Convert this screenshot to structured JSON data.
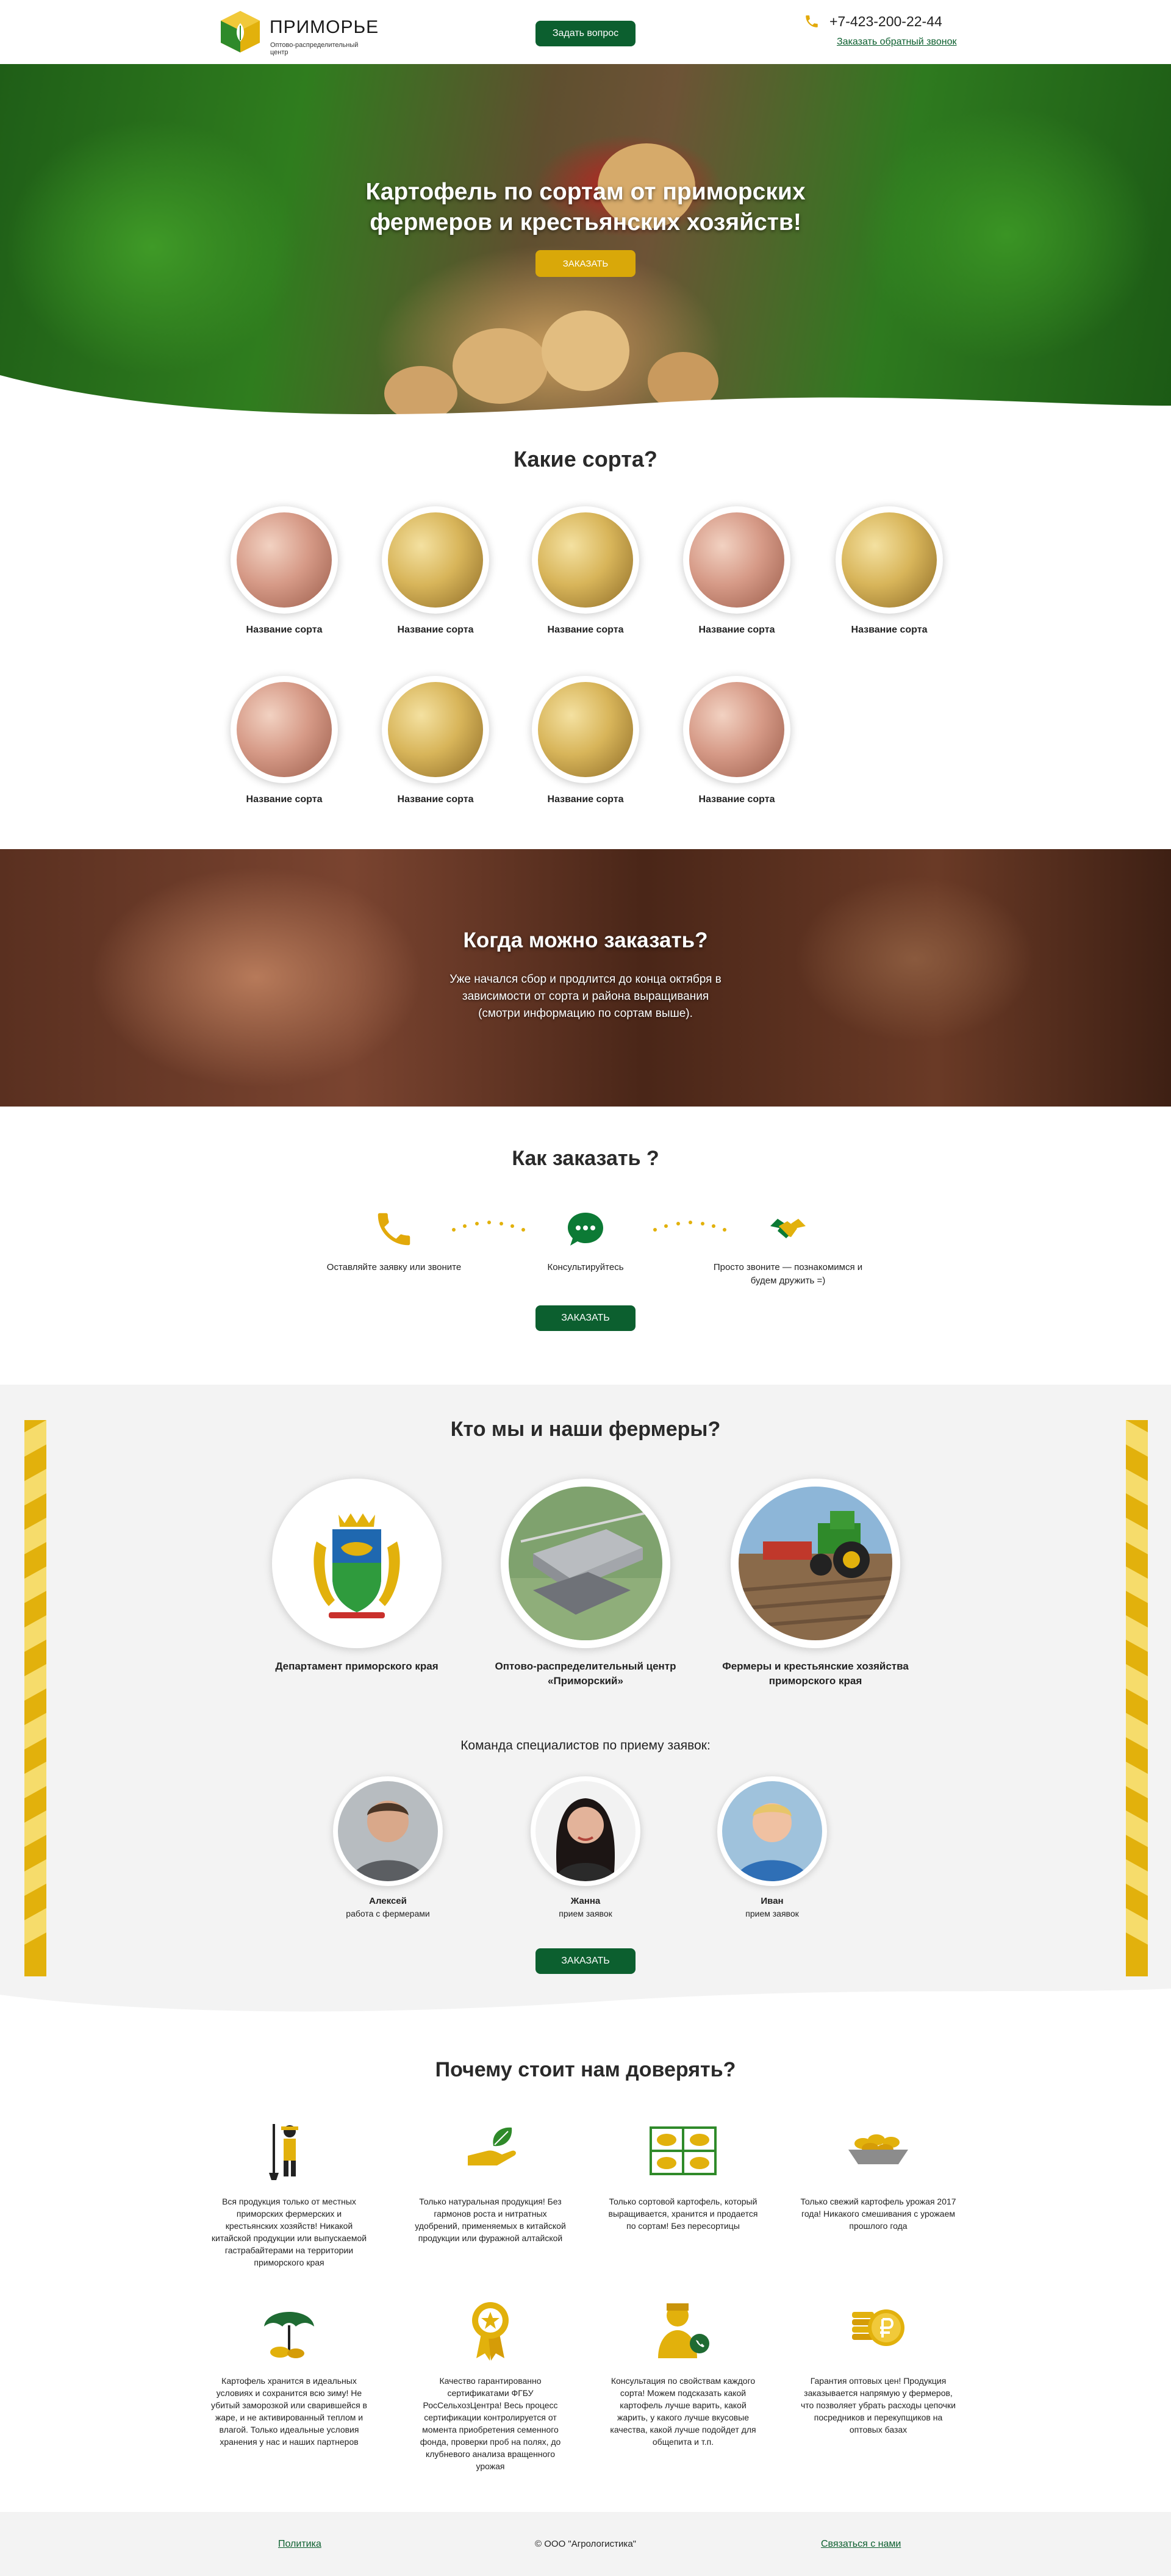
{
  "header": {
    "logo_title": "ПРИМОРЬЕ",
    "logo_subtitle": "Оптово-распределительный центр",
    "ask_button": "Задать вопрос",
    "phone": "+7-423-200-22-44",
    "callback_link": "Заказать обратный звонок"
  },
  "hero": {
    "title": "Картофель по сортам от приморских фермеров и крестьянских хозяйств!",
    "order_button": "ЗАКАЗАТЬ"
  },
  "sorts": {
    "title": "Какие сорта?",
    "items": [
      {
        "label": "Название сорта",
        "color": "pink"
      },
      {
        "label": "Название сорта",
        "color": "yellow"
      },
      {
        "label": "Название сорта",
        "color": "yellow"
      },
      {
        "label": "Название сорта",
        "color": "pink"
      },
      {
        "label": "Название сорта",
        "color": "yellow"
      },
      {
        "label": "Название сорта",
        "color": "pink"
      },
      {
        "label": "Название сорта",
        "color": "yellow"
      },
      {
        "label": "Название сорта",
        "color": "yellow"
      },
      {
        "label": "Название сорта",
        "color": "pink"
      }
    ]
  },
  "when": {
    "title": "Когда можно заказать?",
    "text": "Уже начался сбор и продлится до конца октября в зависимости от сорта и района выращивания (смотри информацию по сортам выше)."
  },
  "how": {
    "title": "Как заказать ?",
    "steps": [
      {
        "label": "Оставляйте заявку или звоните",
        "icon": "phone-icon"
      },
      {
        "label": "Консультируйтесь",
        "icon": "chat-bubble-icon"
      },
      {
        "label": "Просто звоните — познакомимся и будем дружить =)",
        "icon": "handshake-icon"
      }
    ],
    "order_button": "ЗАКАЗАТЬ"
  },
  "who": {
    "title": "Кто мы и наши фермеры?",
    "items": [
      {
        "label": "Департамент приморского края",
        "icon": "coat-of-arms"
      },
      {
        "label": "Оптово-распределительный центр «Приморский»",
        "icon": "aerial-warehouse"
      },
      {
        "label": "Фермеры и крестьянские хозяйства приморского края",
        "icon": "tractor-field"
      }
    ],
    "team_title": "Команда специалистов по приему заявок:",
    "team": [
      {
        "name": "Алексей",
        "role": "работа с фермерами"
      },
      {
        "name": "Жанна",
        "role": "прием заявок"
      },
      {
        "name": "Иван",
        "role": "прием заявок"
      }
    ],
    "order_button": "ЗАКАЗАТЬ"
  },
  "trust": {
    "title": "Почему стоит нам доверять?",
    "items": [
      {
        "text": "Вся продукция только от местных приморских фермерских и крестьянских хозяйств! Никакой китайской продукции или выпускаемой гастрабайтерами на территории приморского края",
        "icon": "farmer-icon"
      },
      {
        "text": "Только натуральная продукция! Без гармонов роста и нитратных удобрений, применяемых в китайской продукции или фуражной алтайской",
        "icon": "hand-leaf-icon"
      },
      {
        "text": "Только сортовой картофель, который выращивается, хранится и продается по сортам! Без пересортицы",
        "icon": "sorted-boxes-icon"
      },
      {
        "text": "Только свежий картофель урожая 2017 года! Никакого смешивания с урожаем прошлого года",
        "icon": "potato-bowl-icon"
      },
      {
        "text": "Картофель хранится в идеальных условиях и сохранится всю зиму! Не убитый заморозкой или сварившейся в жаре, и не активированный теплом и влагой. Только идеальные условия хранения у нас и наших партнеров",
        "icon": "umbrella-icon"
      },
      {
        "text": "Качество гарантированно сертификатами ФГБУ РосСельхозЦентра! Весь процесс сертификации контролируется от момента приобретения семенного фонда, проверки проб на полях, до клубневого анализа вращенного урожая",
        "icon": "award-icon"
      },
      {
        "text": "Консультация по свойствам каждого сорта! Можем подсказать какой картофель лучше варить, какой жарить, у какого лучше вкусовые качества, какой лучше подойдет для общепита и т.п.",
        "icon": "consultant-icon"
      },
      {
        "text": "Гарантия оптовых цен! Продукция заказывается напрямую у фермеров, что позволяет убрать расходы цепочки посредников и перекупщиков на оптовых базах",
        "icon": "ruble-coins-icon"
      }
    ]
  },
  "footer": {
    "policy_link": "Политика",
    "copyright": "© ООО \"Агрологистика\"",
    "contact_link": "Связаться с нами"
  },
  "colors": {
    "brand_green": "#0c5f2f",
    "accent_yellow": "#d9a809",
    "section_gray": "#f3f3f3"
  }
}
